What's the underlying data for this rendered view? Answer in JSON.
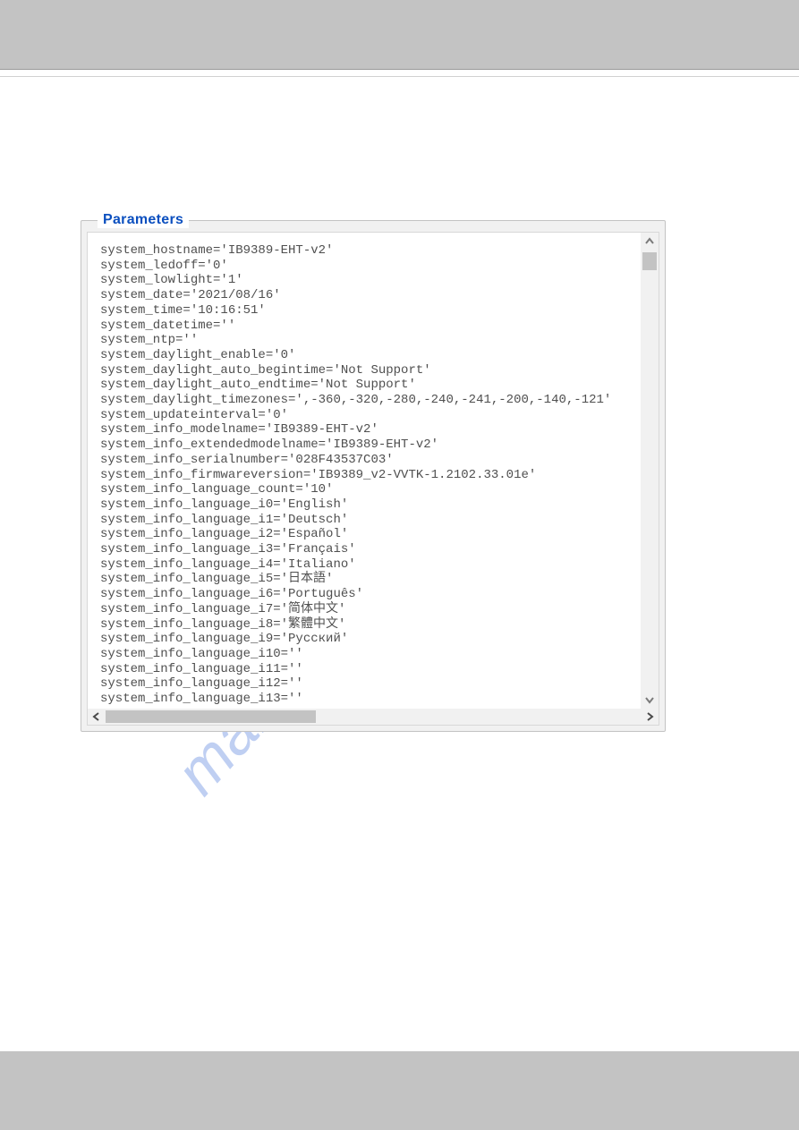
{
  "panel": {
    "legend": "Parameters"
  },
  "watermark": {
    "text": "manualshive.com"
  },
  "parameters": [
    {
      "key": "system_hostname",
      "value": "IB9389-EHT-v2"
    },
    {
      "key": "system_ledoff",
      "value": "0"
    },
    {
      "key": "system_lowlight",
      "value": "1"
    },
    {
      "key": "system_date",
      "value": "2021/08/16"
    },
    {
      "key": "system_time",
      "value": "10:16:51"
    },
    {
      "key": "system_datetime",
      "value": ""
    },
    {
      "key": "system_ntp",
      "value": ""
    },
    {
      "key": "system_daylight_enable",
      "value": "0"
    },
    {
      "key": "system_daylight_auto_begintime",
      "value": "Not Support"
    },
    {
      "key": "system_daylight_auto_endtime",
      "value": "Not Support"
    },
    {
      "key": "system_daylight_timezones",
      "value": ",-360,-320,-280,-240,-241,-200,-140,-121"
    },
    {
      "key": "system_updateinterval",
      "value": "0"
    },
    {
      "key": "system_info_modelname",
      "value": "IB9389-EHT-v2"
    },
    {
      "key": "system_info_extendedmodelname",
      "value": "IB9389-EHT-v2"
    },
    {
      "key": "system_info_serialnumber",
      "value": "028F43537C03"
    },
    {
      "key": "system_info_firmwareversion",
      "value": "IB9389_v2-VVTK-1.2102.33.01e"
    },
    {
      "key": "system_info_language_count",
      "value": "10"
    },
    {
      "key": "system_info_language_i0",
      "value": "English"
    },
    {
      "key": "system_info_language_i1",
      "value": "Deutsch"
    },
    {
      "key": "system_info_language_i2",
      "value": "Español"
    },
    {
      "key": "system_info_language_i3",
      "value": "Français"
    },
    {
      "key": "system_info_language_i4",
      "value": "Italiano"
    },
    {
      "key": "system_info_language_i5",
      "value": "日本語"
    },
    {
      "key": "system_info_language_i6",
      "value": "Português"
    },
    {
      "key": "system_info_language_i7",
      "value": "简体中文"
    },
    {
      "key": "system_info_language_i8",
      "value": "繁體中文"
    },
    {
      "key": "system_info_language_i9",
      "value": "Русский"
    },
    {
      "key": "system_info_language_i10",
      "value": ""
    },
    {
      "key": "system_info_language_i11",
      "value": ""
    },
    {
      "key": "system_info_language_i12",
      "value": ""
    },
    {
      "key": "system_info_language_i13",
      "value": ""
    }
  ]
}
